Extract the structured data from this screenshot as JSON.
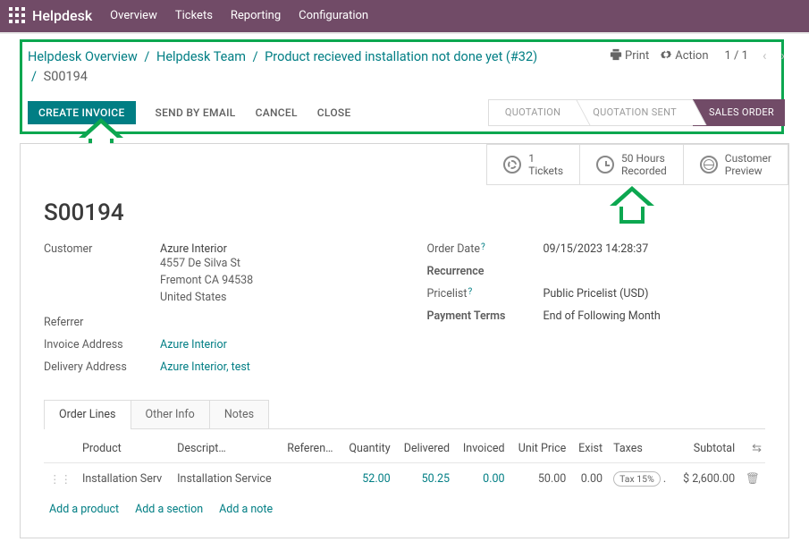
{
  "nav": {
    "brand": "Helpdesk",
    "items": [
      "Overview",
      "Tickets",
      "Reporting",
      "Configuration"
    ]
  },
  "breadcrumb": {
    "items": [
      "Helpdesk Overview",
      "Helpdesk Team",
      "Product recieved installation not done yet (#32)"
    ],
    "current": "S00194"
  },
  "controls": {
    "print": "Print",
    "action": "Action",
    "pager": "1 / 1"
  },
  "actions": {
    "create_invoice": "CREATE INVOICE",
    "send_email": "SEND BY EMAIL",
    "cancel": "CANCEL",
    "close": "CLOSE"
  },
  "status": {
    "quotation": "QUOTATION",
    "quotation_sent": "QUOTATION SENT",
    "sales_order": "SALES ORDER"
  },
  "statboxes": {
    "tickets_v": "1",
    "tickets_l": "Tickets",
    "hours_v": "50 Hours",
    "hours_l": "Recorded",
    "cust_v": "Customer",
    "cust_l": "Preview"
  },
  "order": {
    "name": "S00194",
    "customer_label": "Customer",
    "customer_name": "Azure Interior",
    "customer_addr1": "4557 De Silva St",
    "customer_addr2": "Fremont CA 94538",
    "customer_addr3": "United States",
    "referrer_label": "Referrer",
    "referrer_value": "",
    "invoice_addr_label": "Invoice Address",
    "invoice_addr_value": "Azure Interior",
    "delivery_addr_label": "Delivery Address",
    "delivery_addr_value": "Azure Interior, test",
    "order_date_label": "Order Date",
    "order_date_value": "09/15/2023 14:28:37",
    "recurrence_label": "Recurrence",
    "recurrence_value": "",
    "pricelist_label": "Pricelist",
    "pricelist_value": "Public Pricelist (USD)",
    "payterms_label": "Payment Terms",
    "payterms_value": "End of Following Month"
  },
  "tabs": {
    "order_lines": "Order Lines",
    "other_info": "Other Info",
    "notes": "Notes"
  },
  "table": {
    "headers": {
      "product": "Product",
      "desc": "Descript…",
      "ref": "Referen…",
      "qty": "Quantity",
      "delivered": "Delivered",
      "invoiced": "Invoiced",
      "unit": "Unit Price",
      "exist": "Exist",
      "taxes": "Taxes",
      "subtotal": "Subtotal"
    },
    "row": {
      "product": "Installation Serv",
      "desc": "Installation Service",
      "ref": "",
      "qty": "52.00",
      "delivered": "50.25",
      "invoiced": "0.00",
      "unit": "50.00",
      "exist": "0.00",
      "tax": "Tax 15%",
      "subtotal": "$ 2,600.00"
    },
    "add_product": "Add a product",
    "add_section": "Add a section",
    "add_note": "Add a note"
  },
  "chart_data": null
}
